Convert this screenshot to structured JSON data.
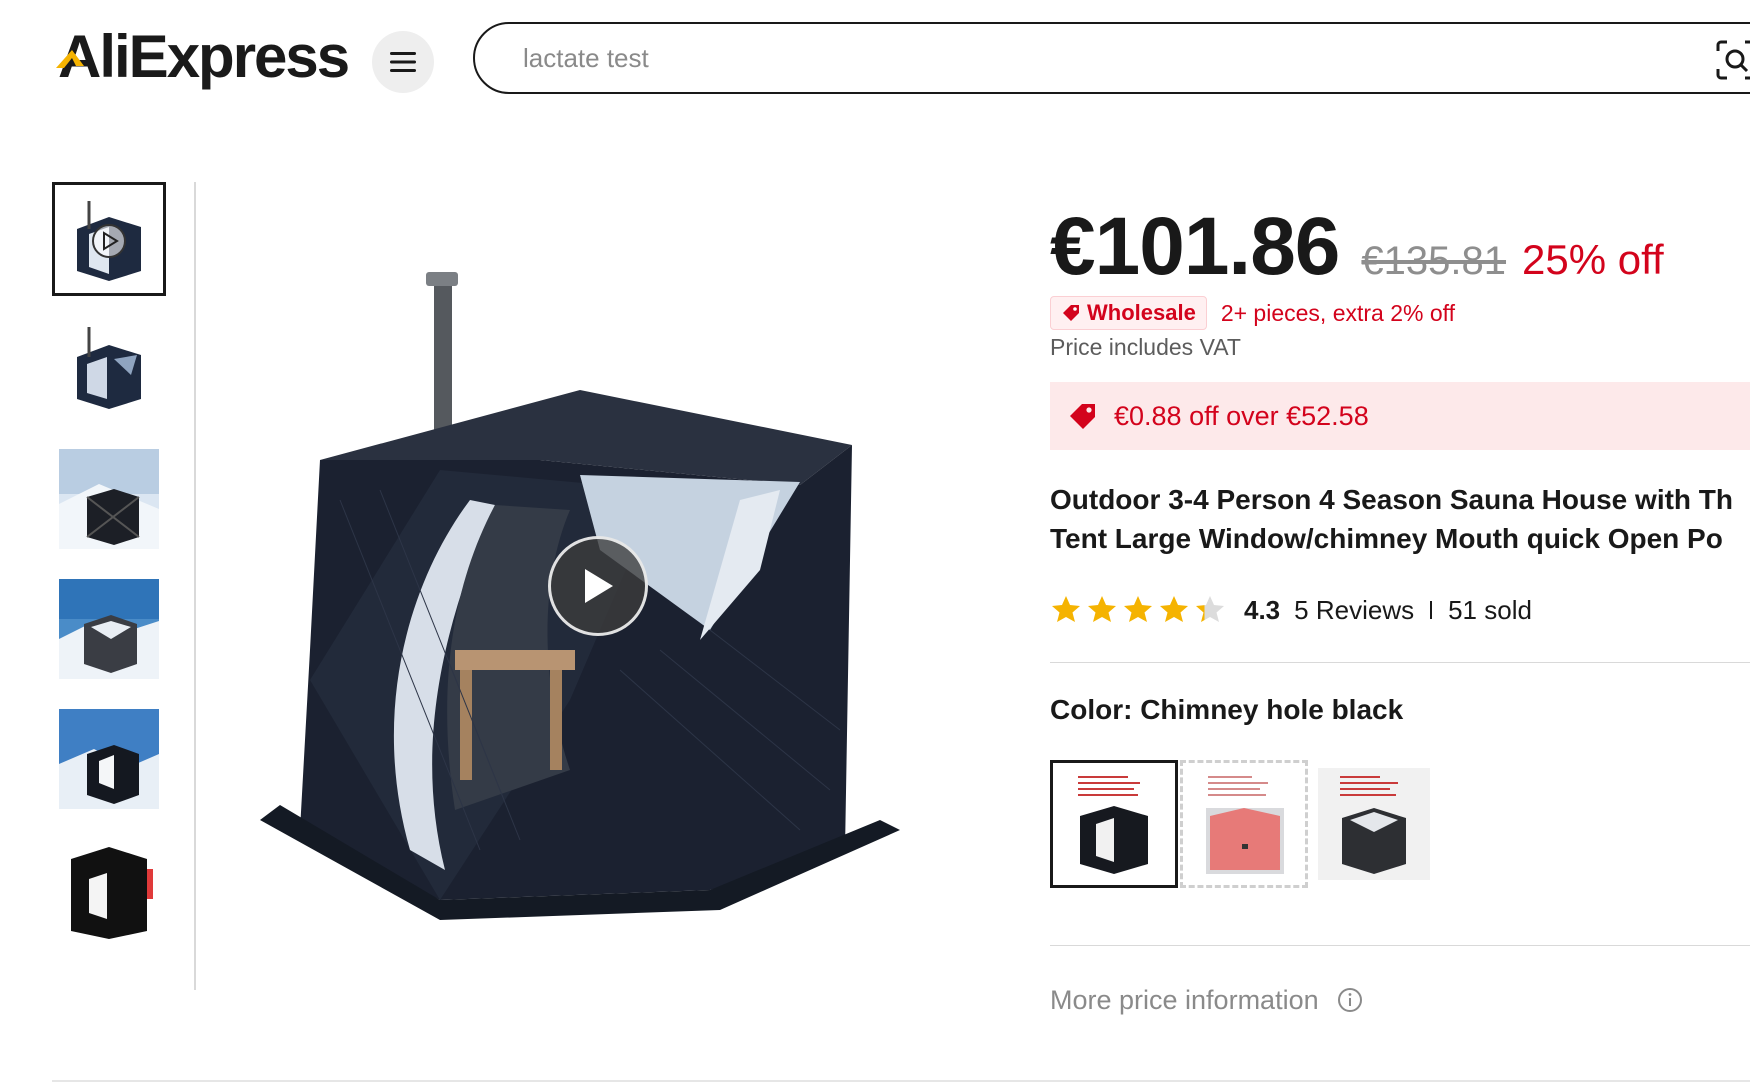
{
  "brand": {
    "logo_text": "AliExpress"
  },
  "search": {
    "placeholder": "lactate test",
    "value": ""
  },
  "product": {
    "price": "€101.86",
    "original_price": "€135.81",
    "discount": "25% off",
    "wholesale_badge": "Wholesale",
    "wholesale_text": "2+ pieces, extra 2% off",
    "vat_note": "Price includes VAT",
    "coupon": "€0.88 off over €52.58",
    "title_line1": "Outdoor 3-4 Person 4 Season Sauna House with Th",
    "title_line2": "Tent Large Window/chimney Mouth quick Open Po",
    "rating": "4.3",
    "rating_stars": 4.3,
    "reviews": "5 Reviews",
    "sold": "51 sold",
    "color_label": "Color: Chimney hole black",
    "more_info": "More price information"
  },
  "colors": {
    "accent_red": "#d3031c",
    "star_gold": "#f5b301",
    "coupon_bg": "#fde9ea"
  },
  "icons": {
    "menu": "hamburger-icon",
    "camera": "image-search-icon",
    "play": "play-icon",
    "tag": "tag-icon",
    "info": "info-icon"
  }
}
